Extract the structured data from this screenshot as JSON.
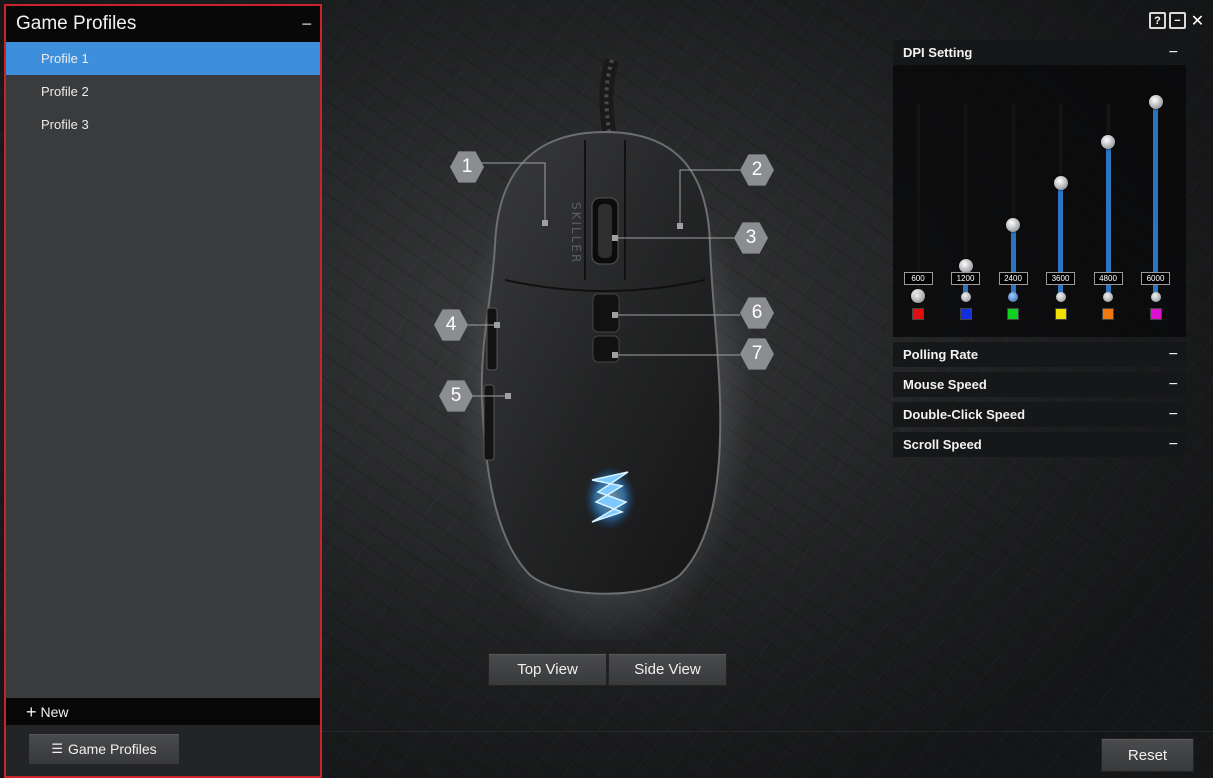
{
  "left_panel": {
    "title": "Game Profiles",
    "collapse_label": "−",
    "profiles": [
      {
        "label": "Profile 1",
        "active": true
      },
      {
        "label": "Profile 2",
        "active": false
      },
      {
        "label": "Profile 3",
        "active": false
      }
    ],
    "new_plus": "+",
    "new_label": "New",
    "footer_button_icon": "☰",
    "footer_button_label": "Game Profiles"
  },
  "window_controls": {
    "help": "?",
    "minimize": "−",
    "close": "✕"
  },
  "mouse": {
    "brand_text": "SKILLER",
    "callouts": [
      "1",
      "2",
      "3",
      "4",
      "5",
      "6",
      "7"
    ]
  },
  "views": {
    "top_label": "Top View",
    "side_label": "Side View"
  },
  "reset_label": "Reset",
  "right_panel": {
    "dpi": {
      "title": "DPI Setting",
      "collapse_label": "−",
      "levels": [
        {
          "value": "600",
          "fill": 0.02,
          "color": "#e01010",
          "active": false
        },
        {
          "value": "1200",
          "fill": 0.17,
          "color": "#1030e0",
          "active": false
        },
        {
          "value": "2400",
          "fill": 0.38,
          "color": "#10d020",
          "active": true
        },
        {
          "value": "3600",
          "fill": 0.59,
          "color": "#f0e000",
          "active": false
        },
        {
          "value": "4800",
          "fill": 0.8,
          "color": "#f07810",
          "active": false
        },
        {
          "value": "6000",
          "fill": 1.0,
          "color": "#e010d0",
          "active": false
        }
      ]
    },
    "sections": [
      {
        "title": "Polling Rate",
        "collapse_label": "−"
      },
      {
        "title": "Mouse Speed",
        "collapse_label": "−"
      },
      {
        "title": "Double-Click Speed",
        "collapse_label": "−"
      },
      {
        "title": "Scroll Speed",
        "collapse_label": "−"
      }
    ]
  }
}
